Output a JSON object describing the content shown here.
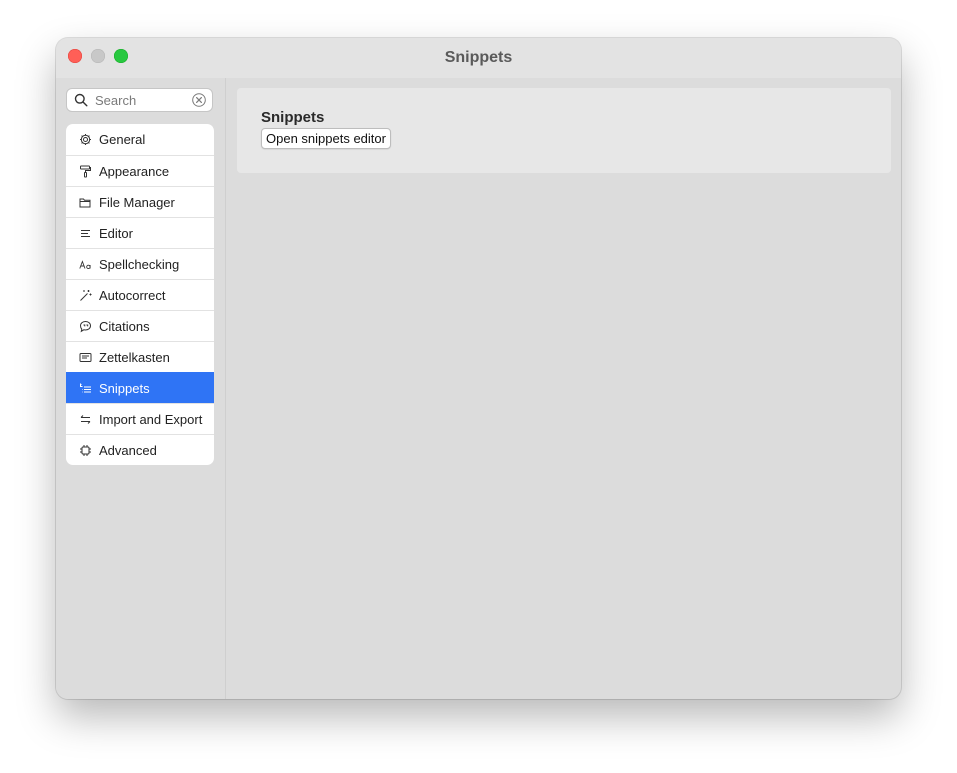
{
  "window": {
    "title": "Snippets"
  },
  "search": {
    "placeholder": "Search"
  },
  "sidebar": {
    "items": [
      {
        "label": "General",
        "icon": "gear-icon"
      },
      {
        "label": "Appearance",
        "icon": "paint-roller-icon"
      },
      {
        "label": "File Manager",
        "icon": "folder-icon"
      },
      {
        "label": "Editor",
        "icon": "text-align-icon"
      },
      {
        "label": "Spellchecking",
        "icon": "text-size-icon"
      },
      {
        "label": "Autocorrect",
        "icon": "magic-wand-icon"
      },
      {
        "label": "Citations",
        "icon": "quote-bubble-icon"
      },
      {
        "label": "Zettelkasten",
        "icon": "card-icon"
      },
      {
        "label": "Snippets",
        "icon": "snippets-list-icon",
        "active": true
      },
      {
        "label": "Import and Export",
        "icon": "import-export-icon"
      },
      {
        "label": "Advanced",
        "icon": "chip-icon"
      }
    ]
  },
  "main": {
    "section_heading": "Snippets",
    "open_editor_label": "Open snippets editor"
  },
  "colors": {
    "accent": "#2f74f5",
    "close": "#ff5f57",
    "minimize": "#c8c8c8",
    "maximize": "#28c840"
  }
}
